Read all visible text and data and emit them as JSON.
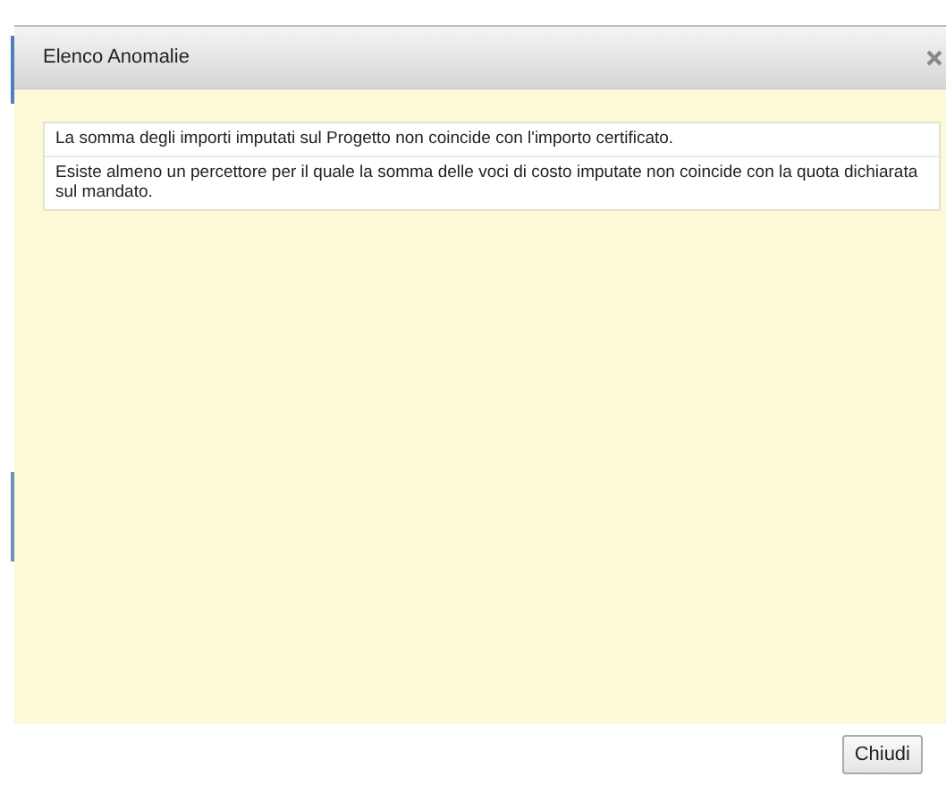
{
  "dialog": {
    "title": "Elenco Anomalie"
  },
  "anomalies": [
    "La somma degli importi imputati sul Progetto non coincide con l'importo certificato.",
    "Esiste almeno un percettore per il quale la somma delle voci di costo imputate non coincide con la quota dichiarata sul mandato."
  ],
  "buttons": [
    "Chiudi"
  ]
}
